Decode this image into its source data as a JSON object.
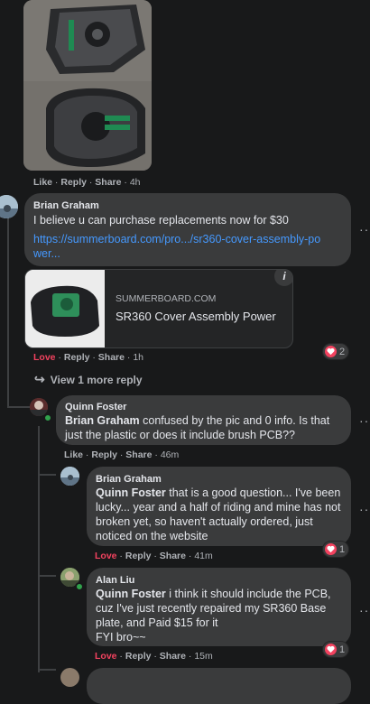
{
  "photo_comment": {
    "actions": {
      "like": "Like",
      "reply": "Reply",
      "share": "Share",
      "time": "4h"
    }
  },
  "brian_comment": {
    "author": "Brian Graham",
    "text": "I believe u can purchase replacements now for $30",
    "link_text": "https://summerboard.com/pro.../sr360-cover-assembly-power...",
    "preview": {
      "domain": "SUMMERBOARD.COM",
      "title": "SR360 Cover Assembly Power",
      "info_icon": "i"
    },
    "actions": {
      "love": "Love",
      "reply": "Reply",
      "share": "Share",
      "time": "1h"
    },
    "reaction_count": "2"
  },
  "view_more": {
    "label": "View 1 more reply"
  },
  "quinn_comment": {
    "author": "Quinn Foster",
    "mention": "Brian Graham",
    "text": " confused by the pic and 0 info. Is that just the plastic or does it include brush PCB??",
    "actions": {
      "like": "Like",
      "reply": "Reply",
      "share": "Share",
      "time": "46m"
    }
  },
  "brian_reply": {
    "author": "Brian Graham",
    "mention": "Quinn Foster",
    "text": " that is a good question... I've been lucky... year and a half of riding and mine has not broken yet, so haven't actually ordered, just noticed on the website",
    "actions": {
      "love": "Love",
      "reply": "Reply",
      "share": "Share",
      "time": "41m"
    },
    "reaction_count": "1"
  },
  "alan_reply": {
    "author": "Alan Liu",
    "mention": "Quinn Foster",
    "text": " i think it should include the PCB, cuz I've just recently repaired my SR360 Base plate, and Paid $15 for it",
    "text2": "FYI bro~~",
    "actions": {
      "love": "Love",
      "reply": "Reply",
      "share": "Share",
      "time": "15m"
    },
    "reaction_count": "1"
  },
  "colors": {
    "background": "#18191a",
    "bubble": "#3a3b3c",
    "link": "#4599ff",
    "love": "#f3425f"
  }
}
